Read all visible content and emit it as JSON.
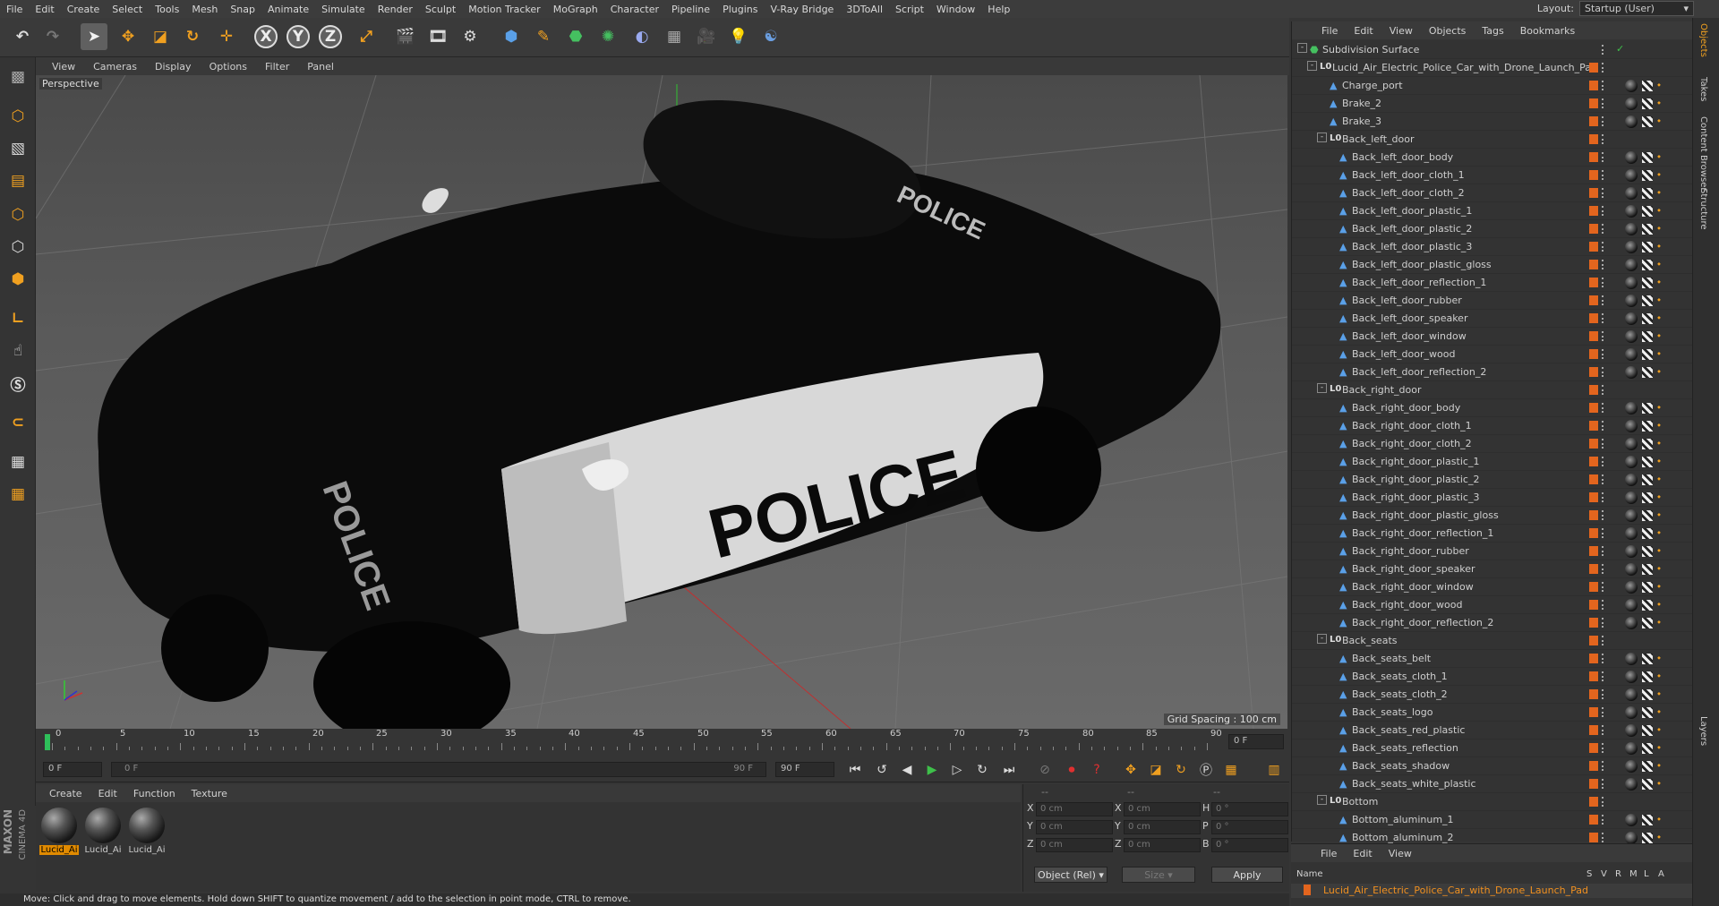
{
  "menubar": {
    "items": [
      "File",
      "Edit",
      "Create",
      "Select",
      "Tools",
      "Mesh",
      "Snap",
      "Animate",
      "Simulate",
      "Render",
      "Sculpt",
      "Motion Tracker",
      "MoGraph",
      "Character",
      "Pipeline",
      "Plugins",
      "V-Ray Bridge",
      "3DToAll",
      "Script",
      "Window",
      "Help"
    ],
    "layout_label": "Layout:",
    "layout_value": "Startup (User)"
  },
  "toolbar": {
    "icons": [
      "undo-icon",
      "redo-icon",
      "select-arrow-icon",
      "move-icon",
      "scale-icon",
      "rotate-icon",
      "live-select-icon",
      "x-axis-icon",
      "y-axis-icon",
      "z-axis-icon",
      "world-coord-icon",
      "render-view-icon",
      "render-picture-viewer-icon",
      "edit-render-settings-icon",
      "cube-icon",
      "pen-icon",
      "subdivision-icon",
      "array-icon",
      "deformer-icon",
      "floor-icon",
      "camera-icon",
      "light-icon",
      "python-icon"
    ],
    "axis_labels": [
      "X",
      "Y",
      "Z"
    ]
  },
  "viewport": {
    "menu": [
      "View",
      "Cameras",
      "Display",
      "Options",
      "Filter",
      "Panel"
    ],
    "label": "Perspective",
    "grid_spacing": "Grid Spacing : 100 cm",
    "car_text": "POLICE"
  },
  "timeline": {
    "ticks": [
      "0",
      "5",
      "10",
      "15",
      "20",
      "25",
      "30",
      "35",
      "40",
      "45",
      "50",
      "55",
      "60",
      "65",
      "70",
      "75",
      "80",
      "85",
      "90"
    ],
    "current_frame": "0 F"
  },
  "transport": {
    "start_field": "0 F",
    "range_start": "0 F",
    "range_end": "90 F",
    "end_field": "90 F"
  },
  "materials": {
    "menu": [
      "Create",
      "Edit",
      "Function",
      "Texture"
    ],
    "items": [
      "Lucid_Ai",
      "Lucid_Ai",
      "Lucid_Ai"
    ]
  },
  "coordinates": {
    "header_left": "--",
    "header_mid": "--",
    "header_right": "--",
    "rows": [
      {
        "a": "X",
        "av": "0 cm",
        "b": "X",
        "bv": "0 cm",
        "c": "H",
        "cv": "0 °"
      },
      {
        "a": "Y",
        "av": "0 cm",
        "b": "Y",
        "bv": "0 cm",
        "c": "P",
        "cv": "0 °"
      },
      {
        "a": "Z",
        "av": "0 cm",
        "b": "Z",
        "bv": "0 cm",
        "c": "B",
        "cv": "0 °"
      }
    ],
    "mode": "Object (Rel)",
    "size": "Size",
    "apply": "Apply"
  },
  "status": "Move: Click and drag to move elements. Hold down SHIFT to quantize movement / add to the selection in point mode, CTRL to remove.",
  "object_manager": {
    "menu": [
      "File",
      "Edit",
      "View",
      "Objects",
      "Tags",
      "Bookmarks"
    ],
    "rows": [
      {
        "name": "Subdivision Surface",
        "level": 0,
        "type": "subdiv",
        "expand": "-",
        "tags": false
      },
      {
        "name": "Lucid_Air_Electric_Police_Car_with_Drone_Launch_Pad",
        "level": 1,
        "type": "null",
        "expand": "-",
        "tags": false
      },
      {
        "name": "Charge_port",
        "level": 2,
        "type": "mesh",
        "expand": "",
        "tags": true
      },
      {
        "name": "Brake_2",
        "level": 2,
        "type": "mesh",
        "expand": "",
        "tags": true
      },
      {
        "name": "Brake_3",
        "level": 2,
        "type": "mesh",
        "expand": "",
        "tags": true
      },
      {
        "name": "Back_left_door",
        "level": 2,
        "type": "null",
        "expand": "-",
        "tags": false
      },
      {
        "name": "Back_left_door_body",
        "level": 3,
        "type": "mesh",
        "expand": "",
        "tags": true
      },
      {
        "name": "Back_left_door_cloth_1",
        "level": 3,
        "type": "mesh",
        "expand": "",
        "tags": true
      },
      {
        "name": "Back_left_door_cloth_2",
        "level": 3,
        "type": "mesh",
        "expand": "",
        "tags": true
      },
      {
        "name": "Back_left_door_plastic_1",
        "level": 3,
        "type": "mesh",
        "expand": "",
        "tags": true
      },
      {
        "name": "Back_left_door_plastic_2",
        "level": 3,
        "type": "mesh",
        "expand": "",
        "tags": true
      },
      {
        "name": "Back_left_door_plastic_3",
        "level": 3,
        "type": "mesh",
        "expand": "",
        "tags": true
      },
      {
        "name": "Back_left_door_plastic_gloss",
        "level": 3,
        "type": "mesh",
        "expand": "",
        "tags": true
      },
      {
        "name": "Back_left_door_reflection_1",
        "level": 3,
        "type": "mesh",
        "expand": "",
        "tags": true
      },
      {
        "name": "Back_left_door_rubber",
        "level": 3,
        "type": "mesh",
        "expand": "",
        "tags": true
      },
      {
        "name": "Back_left_door_speaker",
        "level": 3,
        "type": "mesh",
        "expand": "",
        "tags": true
      },
      {
        "name": "Back_left_door_window",
        "level": 3,
        "type": "mesh",
        "expand": "",
        "tags": true
      },
      {
        "name": "Back_left_door_wood",
        "level": 3,
        "type": "mesh",
        "expand": "",
        "tags": true
      },
      {
        "name": "Back_left_door_reflection_2",
        "level": 3,
        "type": "mesh",
        "expand": "",
        "tags": true
      },
      {
        "name": "Back_right_door",
        "level": 2,
        "type": "null",
        "expand": "-",
        "tags": false
      },
      {
        "name": "Back_right_door_body",
        "level": 3,
        "type": "mesh",
        "expand": "",
        "tags": true
      },
      {
        "name": "Back_right_door_cloth_1",
        "level": 3,
        "type": "mesh",
        "expand": "",
        "tags": true
      },
      {
        "name": "Back_right_door_cloth_2",
        "level": 3,
        "type": "mesh",
        "expand": "",
        "tags": true
      },
      {
        "name": "Back_right_door_plastic_1",
        "level": 3,
        "type": "mesh",
        "expand": "",
        "tags": true
      },
      {
        "name": "Back_right_door_plastic_2",
        "level": 3,
        "type": "mesh",
        "expand": "",
        "tags": true
      },
      {
        "name": "Back_right_door_plastic_3",
        "level": 3,
        "type": "mesh",
        "expand": "",
        "tags": true
      },
      {
        "name": "Back_right_door_plastic_gloss",
        "level": 3,
        "type": "mesh",
        "expand": "",
        "tags": true
      },
      {
        "name": "Back_right_door_reflection_1",
        "level": 3,
        "type": "mesh",
        "expand": "",
        "tags": true
      },
      {
        "name": "Back_right_door_rubber",
        "level": 3,
        "type": "mesh",
        "expand": "",
        "tags": true
      },
      {
        "name": "Back_right_door_speaker",
        "level": 3,
        "type": "mesh",
        "expand": "",
        "tags": true
      },
      {
        "name": "Back_right_door_window",
        "level": 3,
        "type": "mesh",
        "expand": "",
        "tags": true
      },
      {
        "name": "Back_right_door_wood",
        "level": 3,
        "type": "mesh",
        "expand": "",
        "tags": true
      },
      {
        "name": "Back_right_door_reflection_2",
        "level": 3,
        "type": "mesh",
        "expand": "",
        "tags": true
      },
      {
        "name": "Back_seats",
        "level": 2,
        "type": "null",
        "expand": "-",
        "tags": false
      },
      {
        "name": "Back_seats_belt",
        "level": 3,
        "type": "mesh",
        "expand": "",
        "tags": true
      },
      {
        "name": "Back_seats_cloth_1",
        "level": 3,
        "type": "mesh",
        "expand": "",
        "tags": true
      },
      {
        "name": "Back_seats_cloth_2",
        "level": 3,
        "type": "mesh",
        "expand": "",
        "tags": true
      },
      {
        "name": "Back_seats_logo",
        "level": 3,
        "type": "mesh",
        "expand": "",
        "tags": true
      },
      {
        "name": "Back_seats_red_plastic",
        "level": 3,
        "type": "mesh",
        "expand": "",
        "tags": true
      },
      {
        "name": "Back_seats_reflection",
        "level": 3,
        "type": "mesh",
        "expand": "",
        "tags": true
      },
      {
        "name": "Back_seats_shadow",
        "level": 3,
        "type": "mesh",
        "expand": "",
        "tags": true
      },
      {
        "name": "Back_seats_white_plastic",
        "level": 3,
        "type": "mesh",
        "expand": "",
        "tags": true
      },
      {
        "name": "Bottom",
        "level": 2,
        "type": "null",
        "expand": "-",
        "tags": false
      },
      {
        "name": "Bottom_aluminum_1",
        "level": 3,
        "type": "mesh",
        "expand": "",
        "tags": true
      },
      {
        "name": "Bottom_aluminum_2",
        "level": 3,
        "type": "mesh",
        "expand": "",
        "tags": true
      }
    ]
  },
  "layer_manager": {
    "menu": [
      "File",
      "Edit",
      "View"
    ],
    "header_name": "Name",
    "header_cols": [
      "S",
      "V",
      "R",
      "M",
      "L",
      "A"
    ],
    "row_name": "Lucid_Air_Electric_Police_Car_with_Drone_Launch_Pad"
  },
  "right_tabs": [
    "Objects",
    "Takes",
    "Content Browser",
    "Structure",
    "Layers"
  ],
  "brand": {
    "line1": "MAXON",
    "line2": "CINEMA 4D"
  },
  "colors": {
    "accent": "#e08a00",
    "tag_orange": "#e3651e",
    "selection_blue": "#5aa0e8"
  }
}
